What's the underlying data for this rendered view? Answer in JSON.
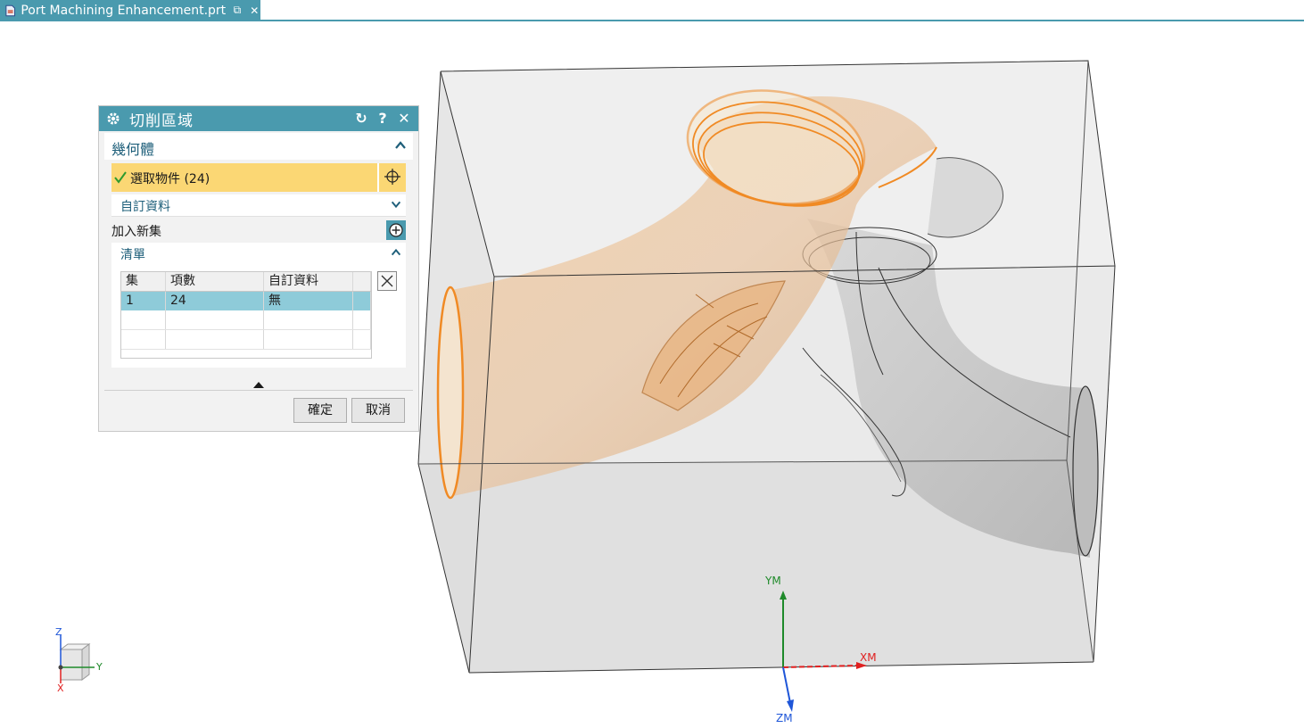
{
  "tab": {
    "title": "Port Machining Enhancement.prt",
    "pin_glyph": "⧉",
    "close_glyph": "✕",
    "icon": "part-file-icon"
  },
  "dialog": {
    "title": "切削區域",
    "icons": {
      "settings": "gear-icon",
      "reset": "reset-icon",
      "help": "help-icon",
      "close": "close-icon"
    },
    "reset_glyph": "↻",
    "help_glyph": "?",
    "close_glyph": "✕",
    "geometry": {
      "label": "幾何體",
      "select_label": "選取物件 (24)",
      "custom_data_label": "自訂資料",
      "add_new_set_label": "加入新集",
      "list": {
        "label": "清單",
        "columns": [
          "集",
          "項數",
          "自訂資料"
        ],
        "rows": [
          {
            "set": "1",
            "count": "24",
            "custom": "無"
          }
        ]
      }
    },
    "ok_label": "確定",
    "cancel_label": "取消"
  },
  "triad": {
    "z": "Z",
    "y": "Y",
    "x": "X"
  },
  "wcs": {
    "ym": "YM",
    "xm": "XM",
    "zm": "ZM"
  },
  "colors": {
    "accent": "#4a9aae",
    "selection": "#fbd774",
    "highlight_edge": "#f08a24",
    "ym_axis": "#1f8a2a",
    "xm_axis": "#e02020",
    "zm_axis": "#1f56d8"
  }
}
